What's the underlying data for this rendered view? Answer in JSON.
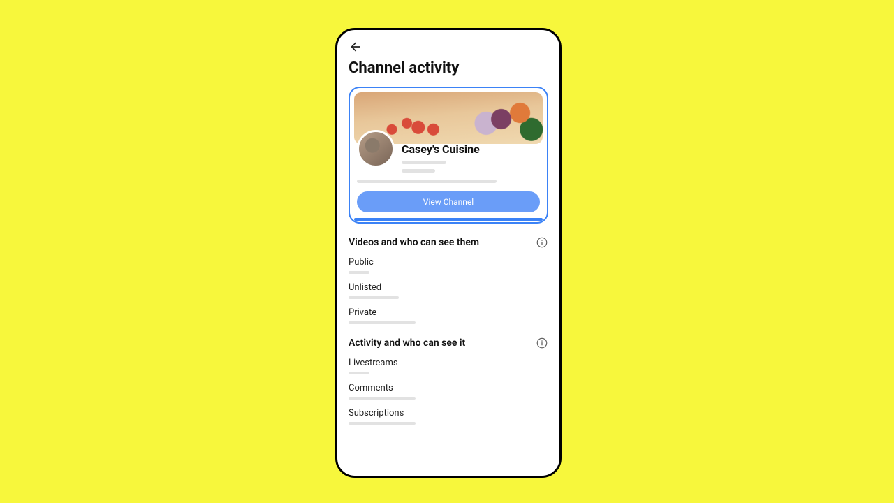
{
  "header": {
    "title": "Channel activity"
  },
  "channel_card": {
    "name": "Casey's Cuisine",
    "view_button": "View Channel"
  },
  "sections": {
    "videos": {
      "title": "Videos and who can see them",
      "items": {
        "public": "Public",
        "unlisted": "Unlisted",
        "private": "Private"
      }
    },
    "activity": {
      "title": "Activity and who can see it",
      "items": {
        "livestreams": "Livestreams",
        "comments": "Comments",
        "subscriptions": "Subscriptions"
      }
    }
  }
}
